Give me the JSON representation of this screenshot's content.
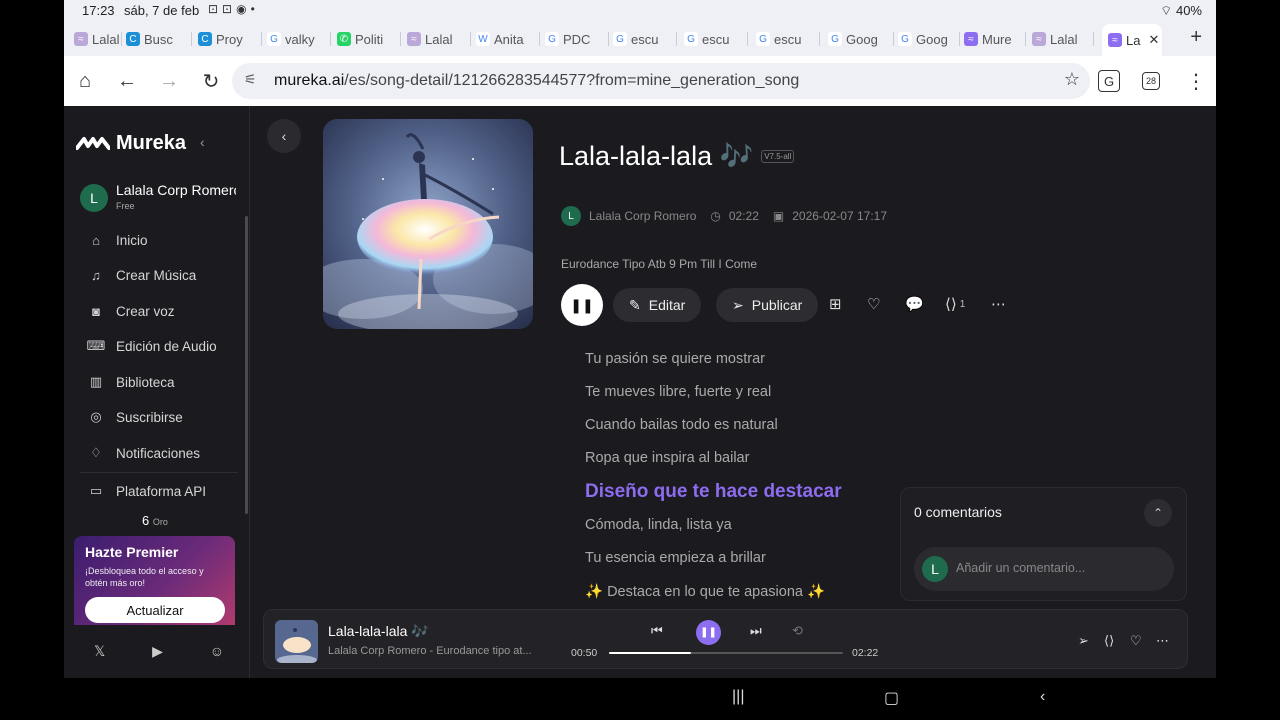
{
  "status": {
    "time": "17:23",
    "date": "sáb, 7 de feb",
    "battery": "40%"
  },
  "tabs": [
    {
      "label": "Lalal",
      "favicon": "mureka-wave-icon",
      "fav_color": "#b9a8d8"
    },
    {
      "label": "Busc",
      "favicon": "c-icon",
      "fav_color": "#1c8fd6"
    },
    {
      "label": "Proy",
      "favicon": "c-icon",
      "fav_color": "#1c8fd6"
    },
    {
      "label": "valky",
      "favicon": "google-icon",
      "fav_color": "#ffffff"
    },
    {
      "label": "Politi",
      "favicon": "whatsapp-icon",
      "fav_color": "#25d366"
    },
    {
      "label": "Lalal",
      "favicon": "mureka-wave-icon",
      "fav_color": "#b9a8d8"
    },
    {
      "label": "Anita",
      "favicon": "wikipedia-icon",
      "fav_color": "#ffffff"
    },
    {
      "label": "PDC",
      "favicon": "google-icon",
      "fav_color": "#ffffff"
    },
    {
      "label": "escu",
      "favicon": "google-icon",
      "fav_color": "#ffffff"
    },
    {
      "label": "escu",
      "favicon": "google-icon",
      "fav_color": "#ffffff"
    },
    {
      "label": "escu",
      "favicon": "google-icon",
      "fav_color": "#ffffff"
    },
    {
      "label": "Goog",
      "favicon": "google-icon",
      "fav_color": "#ffffff"
    },
    {
      "label": "Goog",
      "favicon": "google-icon",
      "fav_color": "#ffffff"
    },
    {
      "label": "Mure",
      "favicon": "mureka-icon",
      "fav_color": "#8e6ef0"
    },
    {
      "label": "Lalal",
      "favicon": "mureka-wave-icon",
      "fav_color": "#b9a8d8"
    },
    {
      "label": "La",
      "favicon": "mureka-icon",
      "fav_color": "#8e6ef0"
    }
  ],
  "browser": {
    "url_host": "mureka.ai",
    "url_path": "/es/song-detail/121266283544577?from=mine_generation_song",
    "tab_count": "28"
  },
  "sidebar": {
    "brand": "Mureka",
    "user_initial": "L",
    "user_name": "Lalala Corp Romero",
    "user_plan": "Free",
    "items": [
      {
        "label": "Inicio",
        "icon": "home-icon"
      },
      {
        "label": "Crear Música",
        "icon": "music-note-icon"
      },
      {
        "label": "Crear voz",
        "icon": "voice-icon"
      },
      {
        "label": "Edición de Audio",
        "icon": "audio-edit-icon"
      },
      {
        "label": "Biblioteca",
        "icon": "library-icon"
      },
      {
        "label": "Suscribirse",
        "icon": "coins-icon"
      },
      {
        "label": "Notificaciones",
        "icon": "bell-icon"
      }
    ],
    "api_label": "Plataforma API",
    "gold_amount": "6",
    "gold_label": "Oro",
    "premium": {
      "title": "Hazte Premier",
      "desc": "¡Desbloquea todo el acceso y obtén más oro!",
      "button": "Actualizar"
    }
  },
  "song": {
    "title": "Lala-lala-lala 🎶",
    "version": "V7.5-all",
    "artist_initial": "L",
    "artist": "Lalala Corp Romero",
    "duration": "02:22",
    "created": "2026-02-07 17:17",
    "genre": "Eurodance Tipo Atb 9 Pm Till I Come",
    "edit_label": "Editar",
    "publish_label": "Publicar",
    "share_count": "1"
  },
  "lyrics": [
    "Tu pasión se quiere mostrar",
    "Te mueves libre, fuerte y real",
    "Cuando bailas todo es natural",
    "Ropa que inspira al bailar",
    "Diseño que te hace destacar",
    "Cómoda, linda, lista ya",
    "Tu esencia empieza a brillar",
    "✨ Destaca en lo que te apasiona ✨"
  ],
  "current_lyric_index": 4,
  "comments": {
    "title": "0 comentarios",
    "placeholder": "Añadir un comentario...",
    "user_initial": "L"
  },
  "player": {
    "title": "Lala-lala-lala 🎶",
    "subtitle": "Lalala Corp Romero - Eurodance tipo at...",
    "elapsed": "00:50",
    "total": "02:22",
    "progress": 0.352
  },
  "colors": {
    "accent": "#8e6ef0",
    "background": "#1b1b1f",
    "avatar": "#1f6b4e"
  }
}
